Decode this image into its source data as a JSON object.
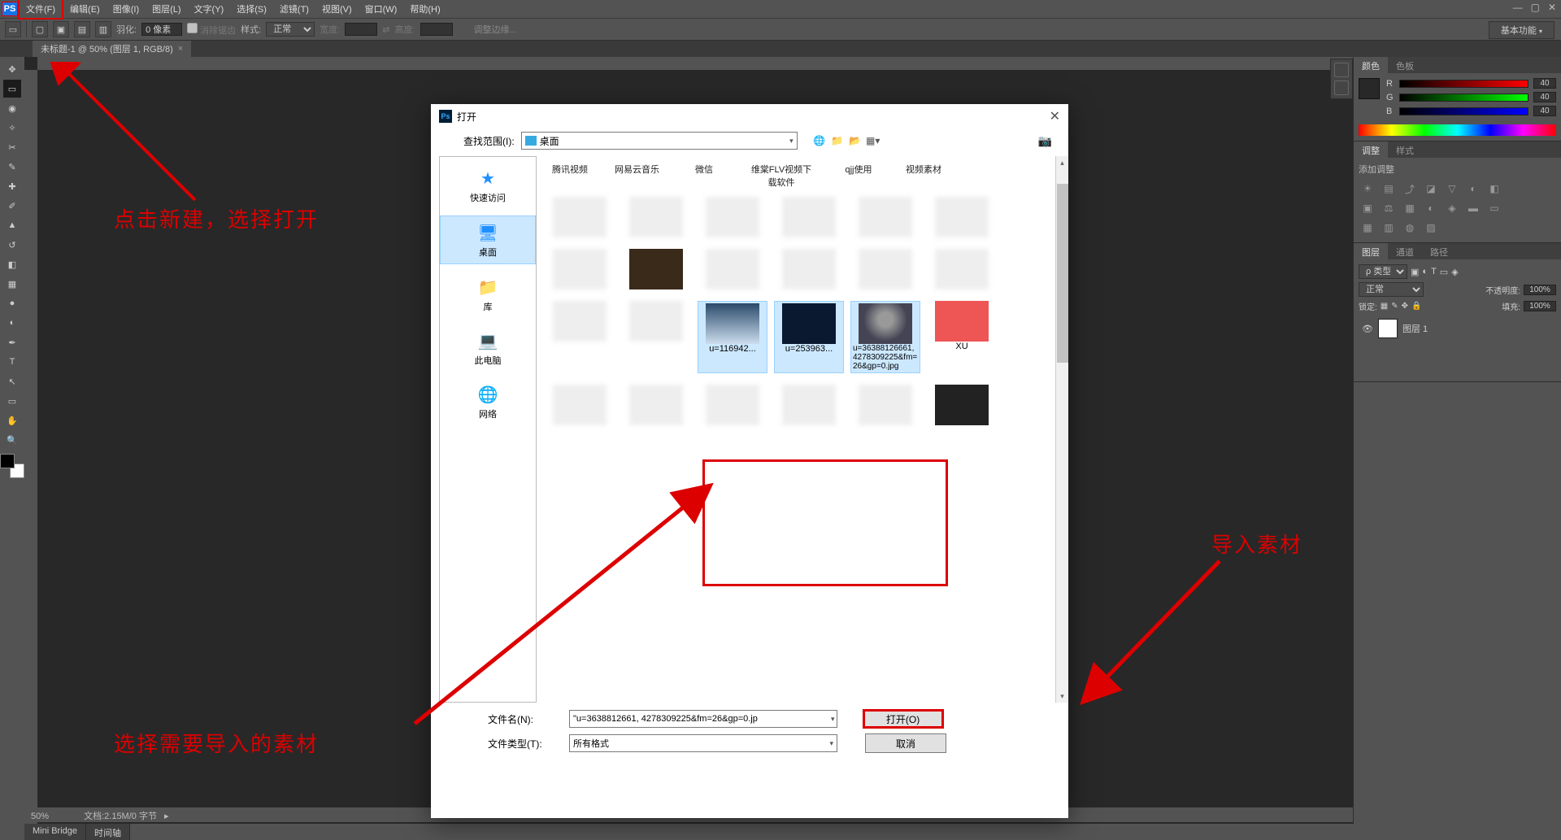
{
  "menubar": {
    "items": [
      "文件(F)",
      "编辑(E)",
      "图像(I)",
      "图层(L)",
      "文字(Y)",
      "选择(S)",
      "滤镜(T)",
      "视图(V)",
      "窗口(W)",
      "帮助(H)"
    ]
  },
  "optionsbar": {
    "feather_label": "羽化:",
    "feather_value": "0 像素",
    "antialias": "消除锯齿",
    "style_label": "样式:",
    "style_value": "正常",
    "width_label": "宽度:",
    "height_label": "高度:",
    "refine": "调整边缘...",
    "workspace": "基本功能"
  },
  "document": {
    "tab": "未标题-1 @ 50% (图层 1, RGB/8)"
  },
  "color_panel": {
    "tabs": [
      "颜色",
      "色板"
    ],
    "r": "40",
    "g": "40",
    "b": "40"
  },
  "adjust_panel": {
    "tabs": [
      "调整",
      "样式"
    ],
    "title": "添加调整"
  },
  "layers_panel": {
    "tabs": [
      "图层",
      "通道",
      "路径"
    ],
    "kind": "类型",
    "blend": "正常",
    "opacity_label": "不透明度:",
    "opacity": "100%",
    "lock_label": "锁定:",
    "fill_label": "填充:",
    "fill": "100%",
    "layer_name": "图层 1"
  },
  "status": {
    "zoom": "50%",
    "doc": "文档:2.15M/0 字节"
  },
  "bottom_tabs": [
    "Mini Bridge",
    "时间轴"
  ],
  "dialog": {
    "title": "打开",
    "look_in_label": "查找范围(I):",
    "look_in_value": "桌面",
    "folders": [
      "腾讯视频",
      "网易云音乐",
      "微信",
      "维棠FLV视频下载软件",
      "qjj使用",
      "视频素材"
    ],
    "sidebar": [
      {
        "label": "快速访问"
      },
      {
        "label": "桌面"
      },
      {
        "label": "库"
      },
      {
        "label": "此电脑"
      },
      {
        "label": "网络"
      }
    ],
    "selected_files": [
      "u=116942...",
      "u=253963...",
      "u=36388126661,4278309225&fm=26&gp=0.jpg"
    ],
    "x_label": "XU",
    "filename_label": "文件名(N):",
    "filename_value": "\"u=3638812661, 4278309225&fm=26&gp=0.jp",
    "filetype_label": "文件类型(T):",
    "filetype_value": "所有格式",
    "open_btn": "打开(O)",
    "cancel_btn": "取消"
  },
  "annotations": {
    "a1": "点击新建，选择打开",
    "a2": "导入素材",
    "a3": "选择需要导入的素材"
  }
}
